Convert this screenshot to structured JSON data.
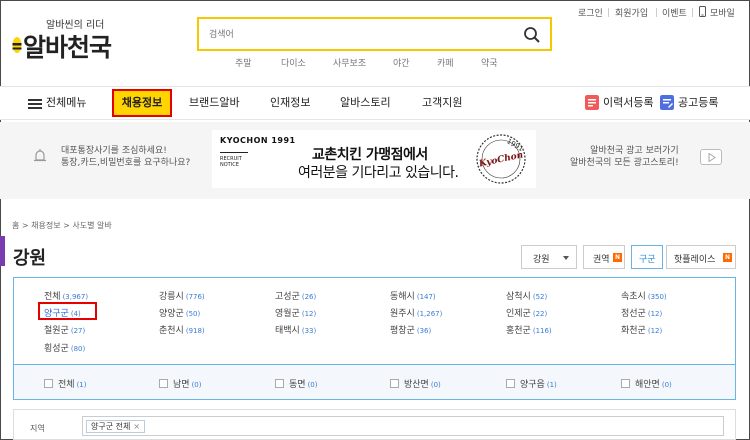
{
  "header": {
    "logo_sub": "알바씬의 리더",
    "logo_main": "알바천국",
    "search_placeholder": "검색어",
    "keywords": [
      "주말",
      "다이소",
      "사무보조",
      "야간",
      "카페",
      "약국"
    ],
    "util_links": [
      "로그인",
      "회원가입",
      "이벤트",
      "모바일"
    ]
  },
  "gnb": {
    "menu_label": "전체메뉴",
    "items": [
      "채용정보",
      "브랜드알바",
      "인재정보",
      "알바스토리",
      "고객지원"
    ],
    "resume_button": "이력서등록",
    "post_button": "공고등록"
  },
  "banner": {
    "notice_line1": "대포통장사기를 조심하세요!",
    "notice_line2": "통장,카드,비밀번호를 요구하나요?",
    "ad_brand": "KYOCHON 1991",
    "ad_sub1": "RECRUIT",
    "ad_sub2": "NOTICE",
    "ad_headline1": "교촌치킨 가맹점에서",
    "ad_headline2": "여러분을 기다리고 있습니다.",
    "ad_seal_text": "KyoChon",
    "ad_seal_year": "1991",
    "ad_info_line1": "알바천국 광고 보러가기",
    "ad_info_line2": "알바천국의 모든 광고스토리!"
  },
  "content": {
    "breadcrumb": "홈 > 채용정보 > 사도별 알바",
    "title": "강원",
    "region_select": "강원",
    "view_tabs": [
      {
        "label": "권역",
        "badge": "N"
      },
      {
        "label": "구군",
        "badge": ""
      },
      {
        "label": "핫플레이스",
        "badge": "N"
      }
    ],
    "cities": [
      {
        "name": "전체",
        "count": "(3,967)"
      },
      {
        "name": "강릉시",
        "count": "(776)"
      },
      {
        "name": "고성군",
        "count": "(26)"
      },
      {
        "name": "동해시",
        "count": "(147)"
      },
      {
        "name": "삼척시",
        "count": "(52)"
      },
      {
        "name": "속초시",
        "count": "(350)"
      },
      {
        "name": "양구군",
        "count": "(4)"
      },
      {
        "name": "양양군",
        "count": "(50)"
      },
      {
        "name": "영월군",
        "count": "(12)"
      },
      {
        "name": "원주시",
        "count": "(1,267)"
      },
      {
        "name": "인제군",
        "count": "(22)"
      },
      {
        "name": "정선군",
        "count": "(12)"
      },
      {
        "name": "철원군",
        "count": "(27)"
      },
      {
        "name": "춘천시",
        "count": "(918)"
      },
      {
        "name": "태백시",
        "count": "(33)"
      },
      {
        "name": "평창군",
        "count": "(36)"
      },
      {
        "name": "홍천군",
        "count": "(116)"
      },
      {
        "name": "화천군",
        "count": "(12)"
      },
      {
        "name": "횡성군",
        "count": "(80)"
      }
    ],
    "dongs": [
      {
        "name": "전체",
        "count": "(1)"
      },
      {
        "name": "남면",
        "count": "(0)"
      },
      {
        "name": "동면",
        "count": "(0)"
      },
      {
        "name": "방산면",
        "count": "(0)"
      },
      {
        "name": "양구읍",
        "count": "(1)"
      },
      {
        "name": "해안면",
        "count": "(0)"
      }
    ],
    "filter_label": "지역",
    "filter_tag": "양구군 전체"
  },
  "colors": {
    "brand_yellow": "#ffd400",
    "highlight_red": "#e60000",
    "link_blue": "#3a7bd5",
    "panel_border": "#69b3e7"
  }
}
